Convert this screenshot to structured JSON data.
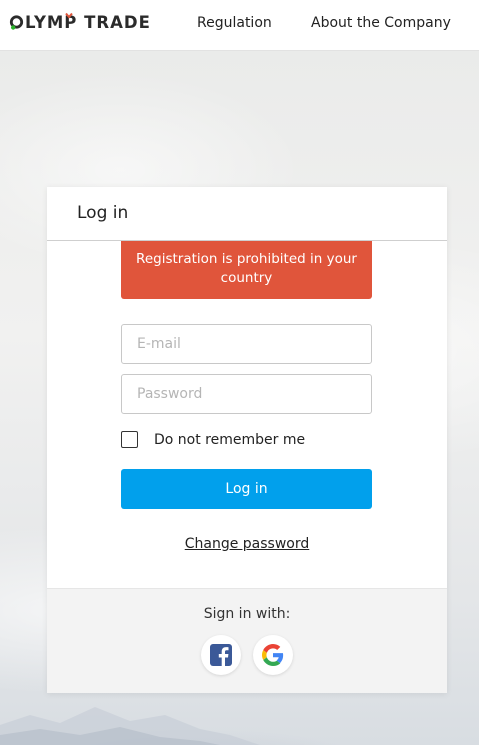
{
  "header": {
    "logo_text": "OLYMP TRADE",
    "nav": [
      {
        "label": "Regulation"
      },
      {
        "label": "About the Company"
      }
    ]
  },
  "login": {
    "title": "Log in",
    "alert": "Registration is prohibited in your country",
    "email_placeholder": "E-mail",
    "email_value": "",
    "password_placeholder": "Password",
    "password_value": "",
    "remember_label": "Do not remember me",
    "remember_checked": false,
    "submit_label": "Log in",
    "change_password_label": "Change password",
    "signin_with_label": "Sign in with:",
    "social": [
      {
        "icon": "facebook-icon",
        "color": "#3b5998"
      },
      {
        "icon": "google-icon",
        "colors": [
          "#4285F4",
          "#EA4335",
          "#FBBC05",
          "#34A853"
        ]
      }
    ]
  },
  "colors": {
    "accent": "#01a0ec",
    "alert": "#e0553b",
    "logo_green": "#2bb32b",
    "logo_red": "#e0553b"
  }
}
